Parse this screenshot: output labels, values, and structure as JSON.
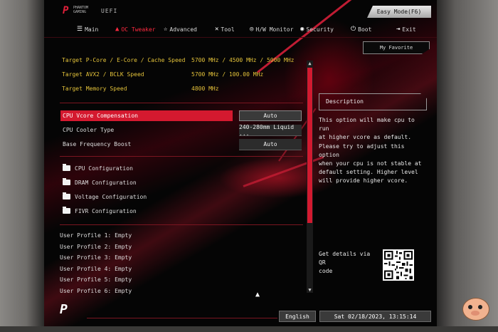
{
  "logo": {
    "brand_line1": "PHANTOM",
    "brand_line2": "GAMING",
    "uefi": "UEFI"
  },
  "header": {
    "easy_mode": "Easy Mode(F6)"
  },
  "nav": {
    "tabs": [
      {
        "label": "Main",
        "icon": "list-icon"
      },
      {
        "label": "OC Tweaker",
        "icon": "flame-icon",
        "active": true
      },
      {
        "label": "Advanced",
        "icon": "star-icon"
      },
      {
        "label": "Tool",
        "icon": "tools-icon"
      },
      {
        "label": "H/W Monitor",
        "icon": "monitor-icon"
      },
      {
        "label": "Security",
        "icon": "shield-icon"
      },
      {
        "label": "Boot",
        "icon": "power-icon"
      },
      {
        "label": "Exit",
        "icon": "exit-icon"
      }
    ]
  },
  "favorite": "My Favorite",
  "info": [
    {
      "label": "Target P-Core / E-Core / Cache Speed",
      "value": "5700 MHz / 4500 MHz / 5000 MHz"
    },
    {
      "label": "Target AVX2 / BCLK Speed",
      "value": "5700 MHz / 100.00 MHz"
    },
    {
      "label": "Target Memory Speed",
      "value": "4800 MHz"
    }
  ],
  "options": [
    {
      "label": "CPU Vcore Compensation",
      "value": "Auto",
      "selected": true
    },
    {
      "label": "CPU Cooler Type",
      "value": "240-280mm Liquid ..."
    },
    {
      "label": "Base Frequency Boost",
      "value": "Auto"
    }
  ],
  "submenus": [
    "CPU Configuration",
    "DRAM Configuration",
    "Voltage Configuration",
    "FIVR Configuration"
  ],
  "profiles": [
    "User Profile 1: Empty",
    "User Profile 2: Empty",
    "User Profile 3: Empty",
    "User Profile 4: Empty",
    "User Profile 5: Empty",
    "User Profile 6: Empty"
  ],
  "description": {
    "title": "Description",
    "text": "This option will make cpu to run\nat higher vcore as default.\nPlease try to adjust this option\nwhen your cpu is not stable at\ndefault setting. Higher level\nwill provide higher vcore.",
    "qr_text": "Get details via QR\ncode"
  },
  "footer": {
    "language": "English",
    "datetime": "Sat 02/18/2023, 13:15:14"
  },
  "colors": {
    "accent": "#d4192f",
    "highlight_text": "#e3c23a",
    "background": "#050505"
  }
}
